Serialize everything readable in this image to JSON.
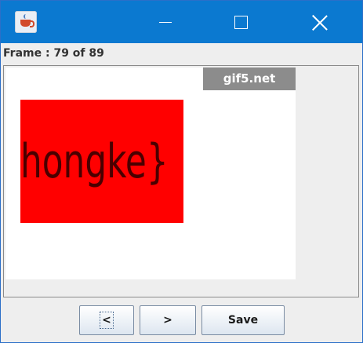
{
  "window": {
    "title": "",
    "title_bar_color": "#0b79d0"
  },
  "status": {
    "frame_label": "Frame : 79 of 89"
  },
  "preview": {
    "watermark": "gif5.net",
    "image_text": "hongke}",
    "image_bg_color": "#ff0000"
  },
  "toolbar": {
    "prev_label": "<",
    "next_label": ">",
    "save_label": "Save"
  },
  "icons": {
    "app": "java-cup-icon",
    "minimize": "minimize-icon",
    "maximize": "maximize-icon",
    "close": "close-icon"
  }
}
